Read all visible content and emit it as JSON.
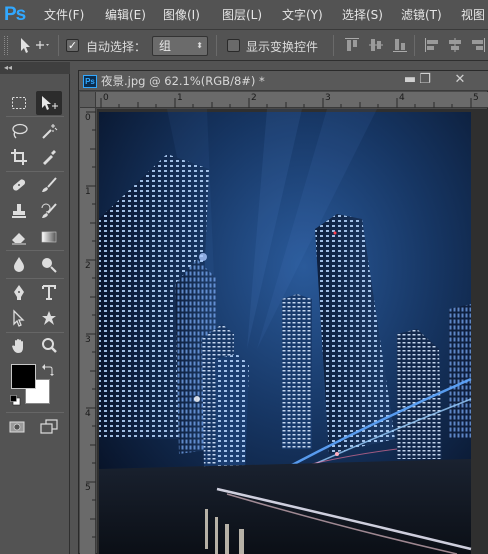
{
  "app": {
    "logo": "Ps"
  },
  "menu": [
    "文件(F)",
    "编辑(E)",
    "图像(I)",
    "图层(L)",
    "文字(Y)",
    "选择(S)",
    "滤镜(T)",
    "视图"
  ],
  "options": {
    "auto_select_label": "自动选择：",
    "auto_select_checked": true,
    "auto_select_value": "组",
    "show_transform_label": "显示变换控件",
    "show_transform_checked": false
  },
  "toolbox": {
    "collapse_label": "◂◂"
  },
  "document": {
    "icon": "Ps",
    "title": "夜景.jpg @ 62.1%(RGB/8#) *",
    "minimize": "▬",
    "restore": "❐",
    "close": "✕"
  },
  "ruler": {
    "top": [
      "0",
      "1",
      "2",
      "3",
      "4",
      "5"
    ],
    "left": [
      "0",
      "1",
      "2",
      "3",
      "4",
      "5"
    ]
  },
  "colors": {
    "foreground": "#000000",
    "background": "#ffffff",
    "accent": "#31a8ff"
  }
}
